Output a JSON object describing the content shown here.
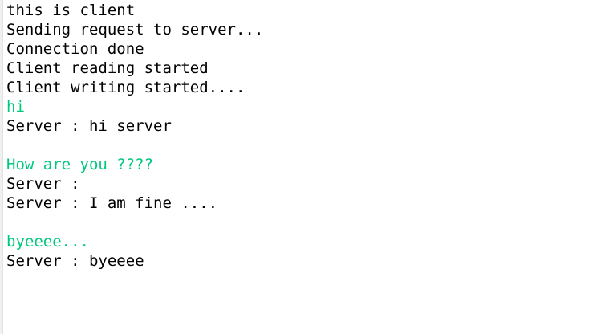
{
  "colors": {
    "output_text": "#000000",
    "user_input_text": "#00c87d",
    "background": "#ffffff"
  },
  "console": {
    "lines": [
      {
        "text": "this is client",
        "kind": "output"
      },
      {
        "text": "Sending request to server...",
        "kind": "output"
      },
      {
        "text": "Connection done",
        "kind": "output"
      },
      {
        "text": "Client reading started",
        "kind": "output"
      },
      {
        "text": "Client writing started....",
        "kind": "output"
      },
      {
        "text": "hi",
        "kind": "input"
      },
      {
        "text": "Server : hi server",
        "kind": "output"
      },
      {
        "text": "",
        "kind": "output"
      },
      {
        "text": "How are you ????",
        "kind": "input"
      },
      {
        "text": "Server :",
        "kind": "output"
      },
      {
        "text": "Server : I am fine ....",
        "kind": "output"
      },
      {
        "text": "",
        "kind": "output"
      },
      {
        "text": "byeeee...",
        "kind": "input"
      },
      {
        "text": "Server : byeeee",
        "kind": "output"
      }
    ]
  }
}
